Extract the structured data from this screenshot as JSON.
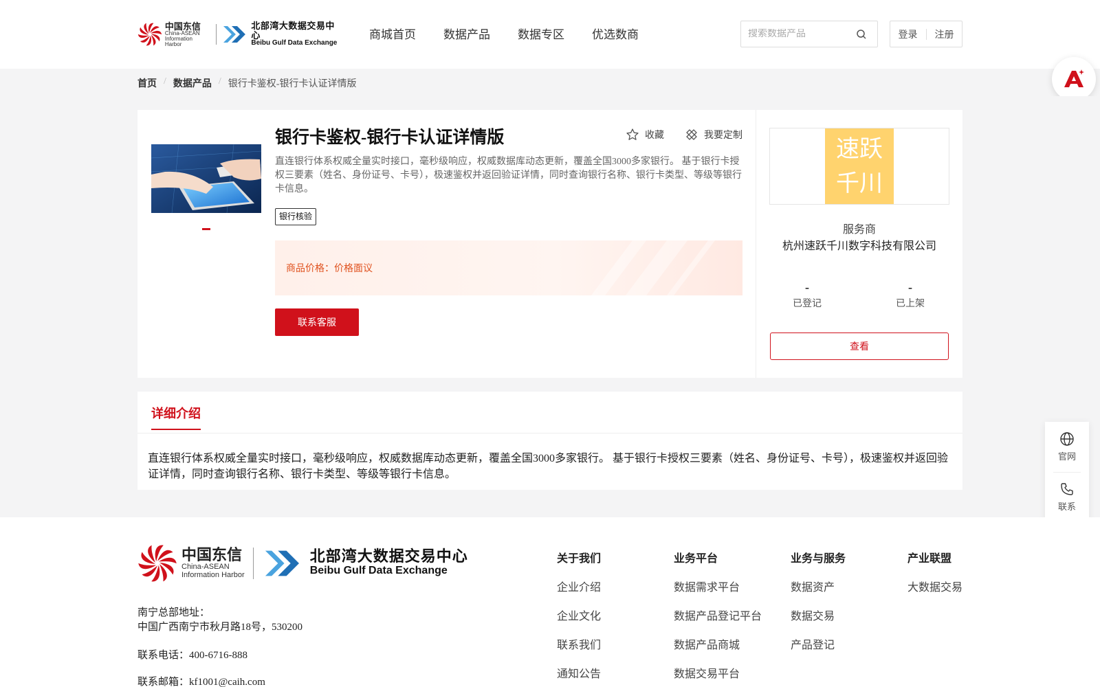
{
  "header": {
    "logo_ca": {
      "cn": "中国东信",
      "en1": "China-ASEAN",
      "en2": "Information Harbor"
    },
    "logo_bg": {
      "cn": "北部湾大数据交易中心",
      "en": "Beibu Gulf Data Exchange"
    },
    "nav": [
      "商城首页",
      "数据产品",
      "数据专区",
      "优选数商"
    ],
    "search_placeholder": "搜索数据产品",
    "login": "登录",
    "register": "注册"
  },
  "breadcrumb": {
    "home": "首页",
    "products": "数据产品",
    "current": "银行卡鉴权-银行卡认证详情版"
  },
  "product": {
    "title": "银行卡鉴权-银行卡认证详情版",
    "favorite": "收藏",
    "customize": "我要定制",
    "description": "直连银行体系权威全量实时接口，毫秒级响应，权威数据库动态更新，覆盖全国3000多家银行。 基于银行卡授权三要素（姓名、身份证号、卡号），极速鉴权并返回验证详情，同时查询银行名称、银行卡类型、等级等银行卡信息。",
    "tag": "银行核验",
    "price_label": "商品价格：",
    "price_value": "价格面议",
    "contact_button": "联系客服"
  },
  "provider": {
    "logo_line1": "速跃",
    "logo_line2": "千川",
    "label": "服务商",
    "name": "杭州速跃千川数字科技有限公司",
    "registered_value": "-",
    "registered_label": "已登记",
    "listed_value": "-",
    "listed_label": "已上架",
    "view_button": "查看"
  },
  "detail": {
    "tab": "详细介绍",
    "text": "直连银行体系权威全量实时接口，毫秒级响应，权威数据库动态更新，覆盖全国3000多家银行。 基于银行卡授权三要素（姓名、身份证号、卡号），极速鉴权并返回验证详情，同时查询银行名称、银行卡类型、等级等银行卡信息。"
  },
  "side": {
    "website": "官网",
    "contact": "联系"
  },
  "footer": {
    "address_label": "南宁总部地址：",
    "address": "中国广西南宁市秋月路18号，530200",
    "phone": "联系电话：400-6716-888",
    "email": "联系邮箱：kf1001@caih.com",
    "columns": [
      {
        "title": "关于我们",
        "items": [
          "企业介绍",
          "企业文化",
          "联系我们",
          "通知公告"
        ]
      },
      {
        "title": "业务平台",
        "items": [
          "数据需求平台",
          "数据产品登记平台",
          "数据产品商城",
          "数据交易平台"
        ]
      },
      {
        "title": "业务与服务",
        "items": [
          "数据资产",
          "数据交易",
          "产品登记"
        ]
      },
      {
        "title": "产业联盟",
        "items": [
          "大数据交易"
        ]
      }
    ]
  },
  "colors": {
    "brand_red": "#d0111b",
    "price_orange": "#e0521f",
    "provider_yellow": "#ffd36e"
  }
}
